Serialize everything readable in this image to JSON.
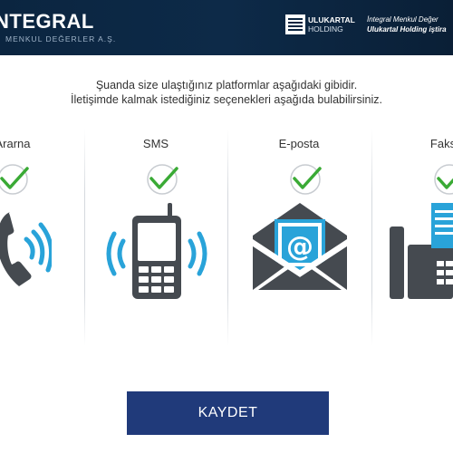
{
  "header": {
    "logo_main": "NTEGRAL",
    "logo_sub": "MENKUL DEĞERLER A.Ş.",
    "holding_name_1": "ULUKARTAL",
    "holding_name_2": "HOLDING",
    "note_line1": "İntegral Menkul Değer",
    "note_line2": "Ulukartal Holding iştira"
  },
  "intro": {
    "line1": "Şuanda size ulaştığınız platformlar aşağıdaki gibidir.",
    "line2": "İletişimde kalmak istediğiniz seçenekleri aşağıda bulabilirsiniz."
  },
  "options": [
    {
      "label": "Ararna",
      "icon": "phone-call-icon",
      "checked": true
    },
    {
      "label": "SMS",
      "icon": "mobile-phone-icon",
      "checked": true
    },
    {
      "label": "E-posta",
      "icon": "email-envelope-icon",
      "checked": true
    },
    {
      "label": "Faks",
      "icon": "fax-machine-icon",
      "checked": true
    }
  ],
  "save_label": "KAYDET",
  "colors": {
    "header_bg": "#0b2540",
    "check_green": "#3aaa35",
    "icon_blue": "#29a3d9",
    "icon_dark": "#454a50",
    "button_bg": "#203a7a"
  }
}
